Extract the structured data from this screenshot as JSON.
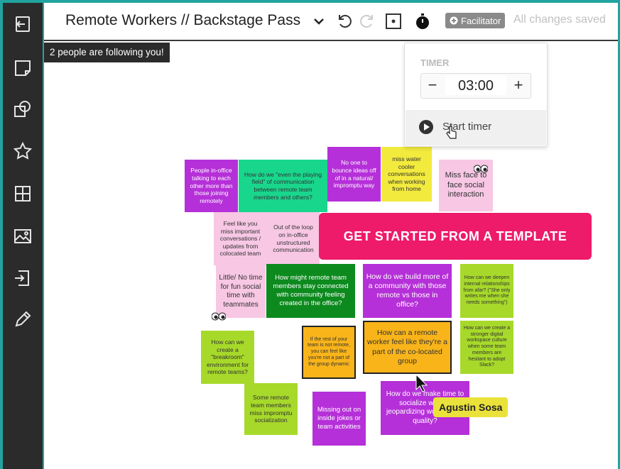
{
  "header": {
    "title": "Remote Workers // Backstage Pass",
    "facilitator_label": "Facilitator",
    "save_status": "All changes saved"
  },
  "banner": {
    "text": "2 people are following you!"
  },
  "sidebar": {
    "items": [
      {
        "icon": "exit-icon"
      },
      {
        "icon": "sticky-note-icon"
      },
      {
        "icon": "shapes-icon"
      },
      {
        "icon": "star-icon"
      },
      {
        "icon": "grid-icon"
      },
      {
        "icon": "image-icon"
      },
      {
        "icon": "import-icon"
      },
      {
        "icon": "pencil-icon"
      }
    ]
  },
  "timer": {
    "label": "TIMER",
    "value": "03:00",
    "decrement": "−",
    "increment": "+",
    "start_label": "Start timer"
  },
  "template_button": {
    "label": "GET STARTED FROM A TEMPLATE"
  },
  "cursor": {
    "user_name": "Agustin Sosa"
  },
  "colors": {
    "purple": "#b530d8",
    "teal": "#19d68d",
    "yellow": "#f2ea3d",
    "pink": "#f7c7e4",
    "green": "#0c8a1e",
    "lime": "#a7d92a",
    "orange": "#f9b41a",
    "accent": "#ee1a6a"
  },
  "notes": [
    {
      "text": "People in-office talking to each other more than those joining remotely",
      "color": "purple"
    },
    {
      "text": "How do we \"even the playing field\" of communication between remote team members and others?",
      "color": "teal"
    },
    {
      "text": "No one to bounce ideas off of in a natural/ impromptu way",
      "color": "purple"
    },
    {
      "text": "miss water cooler conversations when working from home",
      "color": "yellow"
    },
    {
      "text": "Miss face to face social interaction",
      "color": "pink"
    },
    {
      "text": "Feel like you miss important conversations / updates from colocated team",
      "color": "pink"
    },
    {
      "text": "Out of the loop on in-office unstructured communication",
      "color": "pink"
    },
    {
      "text": "Little/ No time for fun social time with teammates",
      "color": "pink"
    },
    {
      "text": "How might remote team members stay connected with community feeling created in the office?",
      "color": "green"
    },
    {
      "text": "How do we build more of a community with those remote vs those in office?",
      "color": "purple"
    },
    {
      "text": "How can we deepen internal relationships from afar? (\"She only writes me when she needs something\")",
      "color": "lime"
    },
    {
      "text": "How can we create a \"breakroom\" environment for remote teams?",
      "color": "lime"
    },
    {
      "text": "If the rest of your team is not remote, you can feel like you're not a part of the group dynamic",
      "color": "orange"
    },
    {
      "text": "How can a remote worker feel like they're a part of the co-located group",
      "color": "orange"
    },
    {
      "text": "How can we create a stronger digital workspace culture when some team members are hesitant to adopt Slack?",
      "color": "lime"
    },
    {
      "text": "Some remote team members miss impromptu socialization",
      "color": "lime"
    },
    {
      "text": "Missing out on inside jokes or team activities",
      "color": "purple"
    },
    {
      "text": "How do we make time to socialize without jeopardizing work time & quality?",
      "color": "purple"
    }
  ]
}
